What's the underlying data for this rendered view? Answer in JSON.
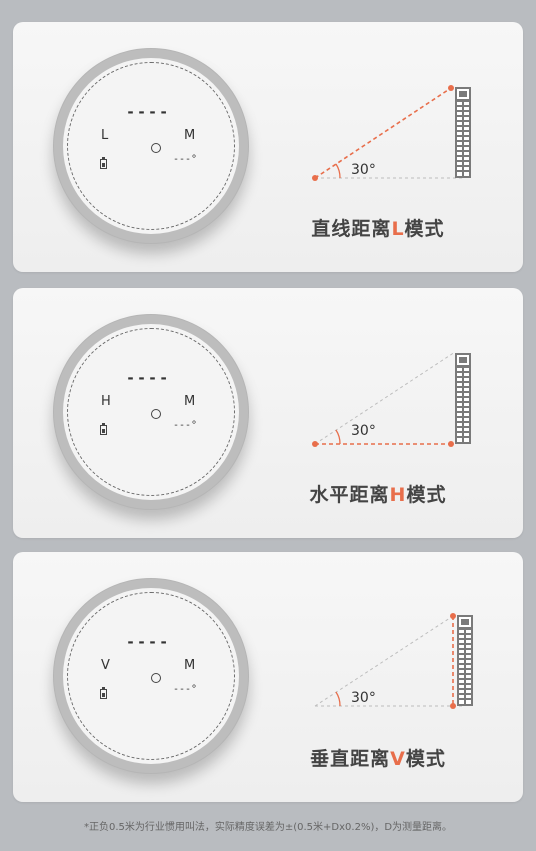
{
  "cards": [
    {
      "readout_dashes": "----",
      "mode_letter": "L",
      "unit_letter": "M",
      "angle_dashes": "---°",
      "diagram_angle": "30°",
      "title_prefix": "直线距离",
      "title_letter": "L",
      "title_suffix": "模式"
    },
    {
      "readout_dashes": "----",
      "mode_letter": "H",
      "unit_letter": "M",
      "angle_dashes": "---°",
      "diagram_angle": "30°",
      "title_prefix": "水平距离",
      "title_letter": "H",
      "title_suffix": "模式"
    },
    {
      "readout_dashes": "----",
      "mode_letter": "V",
      "unit_letter": "M",
      "angle_dashes": "---°",
      "diagram_angle": "30°",
      "title_prefix": "垂直距离",
      "title_letter": "V",
      "title_suffix": "模式"
    }
  ],
  "footnote": "*正负0.5米为行业惯用叫法，实际精度误差为±(0.5米+Dx0.2%)，D为测量距离。",
  "colors": {
    "accent": "#e86e4b",
    "background": "#b9bcc0",
    "card": "#f3f3f3",
    "building": "#7a7a7a"
  }
}
